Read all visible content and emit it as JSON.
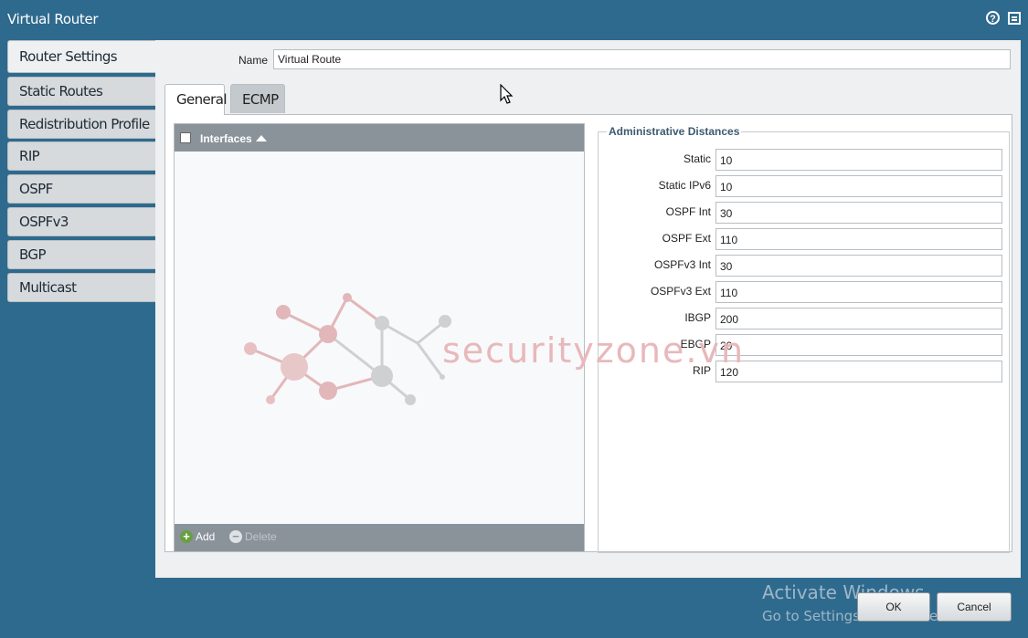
{
  "window": {
    "title": "Virtual Router",
    "help_icon": "?"
  },
  "sidebar": {
    "items": [
      {
        "label": "Router Settings",
        "active": true
      },
      {
        "label": "Static Routes"
      },
      {
        "label": "Redistribution Profile"
      },
      {
        "label": "RIP"
      },
      {
        "label": "OSPF"
      },
      {
        "label": "OSPFv3"
      },
      {
        "label": "BGP"
      },
      {
        "label": "Multicast"
      }
    ]
  },
  "form": {
    "name_label": "Name",
    "name_value": "Virtual Route"
  },
  "tabs": [
    {
      "label": "General",
      "active": true
    },
    {
      "label": "ECMP"
    }
  ],
  "interfaces": {
    "header": "Interfaces",
    "add_label": "Add",
    "delete_label": "Delete"
  },
  "admin_distances": {
    "legend": "Administrative Distances",
    "rows": [
      {
        "label": "Static",
        "value": "10"
      },
      {
        "label": "Static IPv6",
        "value": "10"
      },
      {
        "label": "OSPF Int",
        "value": "30"
      },
      {
        "label": "OSPF Ext",
        "value": "110"
      },
      {
        "label": "OSPFv3 Int",
        "value": "30"
      },
      {
        "label": "OSPFv3 Ext",
        "value": "110"
      },
      {
        "label": "IBGP",
        "value": "200"
      },
      {
        "label": "EBGP",
        "value": "20"
      },
      {
        "label": "RIP",
        "value": "120"
      }
    ]
  },
  "watermark": {
    "text": "securityzone.vn"
  },
  "os_overlay": {
    "line1": "Activate Windows",
    "line2": "Go to Settings to activate Windows."
  },
  "buttons": {
    "ok": "OK",
    "cancel": "Cancel"
  },
  "colors": {
    "frame": "#2e6a8e",
    "panel": "#eef0f1",
    "grid_header": "#8b939a",
    "add_green": "#67a043"
  }
}
